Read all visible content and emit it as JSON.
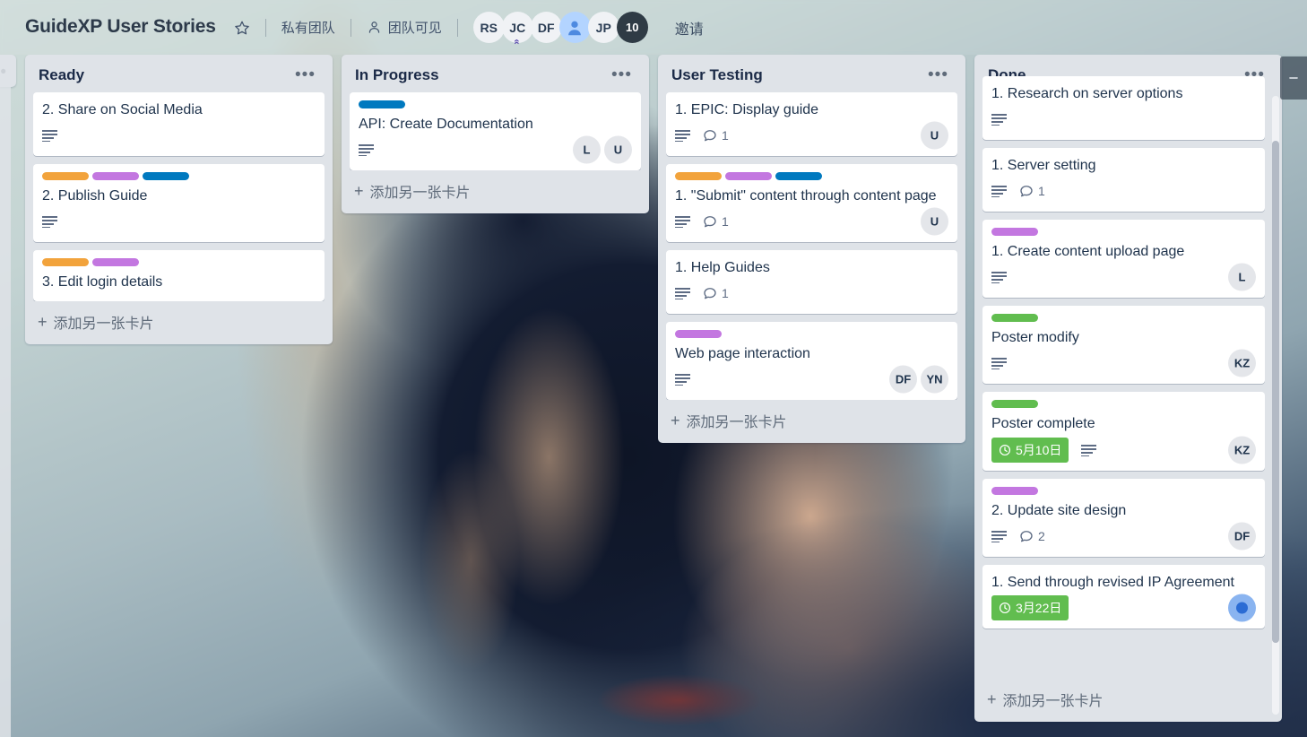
{
  "header": {
    "title": "GuideXP User Stories",
    "star_icon": "star-icon",
    "visibility_private": "私有团队",
    "visibility_team": "团队可见",
    "team_icon": "people-icon",
    "invite_label": "邀请",
    "members": [
      {
        "initials": "RS",
        "type": "initials"
      },
      {
        "initials": "JC",
        "type": "initials",
        "badge": "chevron-up"
      },
      {
        "initials": "DF",
        "type": "initials"
      },
      {
        "initials": "",
        "type": "photo"
      },
      {
        "initials": "JP",
        "type": "initials"
      },
      {
        "initials": "10",
        "type": "count"
      }
    ]
  },
  "board": {
    "add_card_label": "添加另一张卡片",
    "add_icon": "plus-icon",
    "list_menu_icon": "ellipsis-icon",
    "lists": [
      {
        "name": "Ready",
        "cards": [
          {
            "title": "2. Share on Social Media",
            "labels": [],
            "description": true,
            "comments": null,
            "due": null,
            "members": []
          },
          {
            "title": "2. Publish Guide",
            "labels": [
              "#f2a33c",
              "#c377e0",
              "#0079bf"
            ],
            "description": true,
            "comments": null,
            "due": null,
            "members": []
          },
          {
            "title": "3. Edit login details",
            "labels": [
              "#f2a33c",
              "#c377e0"
            ],
            "description": false,
            "comments": null,
            "due": null,
            "members": []
          }
        ]
      },
      {
        "name": "In Progress",
        "cards": [
          {
            "title": "API: Create Documentation",
            "labels": [
              "#0079bf"
            ],
            "description": true,
            "comments": null,
            "due": null,
            "members": [
              "L",
              "U"
            ]
          }
        ]
      },
      {
        "name": "User Testing",
        "cards": [
          {
            "title": "1. EPIC: Display guide",
            "labels": [],
            "description": true,
            "comments": "1",
            "due": null,
            "members": [
              "U"
            ]
          },
          {
            "title": "1. \"Submit\" content through content page",
            "labels": [
              "#f2a33c",
              "#c377e0",
              "#0079bf"
            ],
            "description": true,
            "comments": "1",
            "due": null,
            "members": [
              "U"
            ]
          },
          {
            "title": "1. Help Guides",
            "labels": [],
            "description": true,
            "comments": "1",
            "due": null,
            "members": []
          },
          {
            "title": "Web page interaction",
            "labels": [
              "#c377e0"
            ],
            "description": true,
            "comments": null,
            "due": null,
            "members": [
              "DF",
              "YN"
            ]
          }
        ]
      },
      {
        "name": "Done",
        "scrolled": true,
        "cards": [
          {
            "title": "1. Research on server options",
            "labels": [],
            "description": true,
            "comments": null,
            "due": null,
            "members": []
          },
          {
            "title": "1. Server setting",
            "labels": [],
            "description": true,
            "comments": "1",
            "due": null,
            "members": []
          },
          {
            "title": "1. Create content upload page",
            "labels": [
              "#c377e0"
            ],
            "description": true,
            "comments": null,
            "due": null,
            "members": [
              "L"
            ]
          },
          {
            "title": "Poster modify",
            "labels": [
              "#61bd4f"
            ],
            "description": true,
            "comments": null,
            "due": null,
            "members": [
              "KZ"
            ]
          },
          {
            "title": "Poster complete",
            "labels": [
              "#61bd4f"
            ],
            "description": true,
            "comments": null,
            "due": "5月10日",
            "members": [
              "KZ"
            ]
          },
          {
            "title": "2. Update site design",
            "labels": [
              "#c377e0"
            ],
            "description": true,
            "comments": "2",
            "due": null,
            "members": [
              "DF"
            ]
          },
          {
            "title": "1. Send through revised IP Agreement",
            "labels": [],
            "description": false,
            "comments": null,
            "due": "3月22日",
            "members": [
              "photo"
            ]
          }
        ]
      }
    ]
  },
  "colors": {
    "label_orange": "#f2a33c",
    "label_purple": "#c377e0",
    "label_blue": "#0079bf",
    "label_green": "#61bd4f",
    "list_background": "#dfe3e8",
    "card_background": "#ffffff",
    "due_badge": "#61bd4f"
  }
}
